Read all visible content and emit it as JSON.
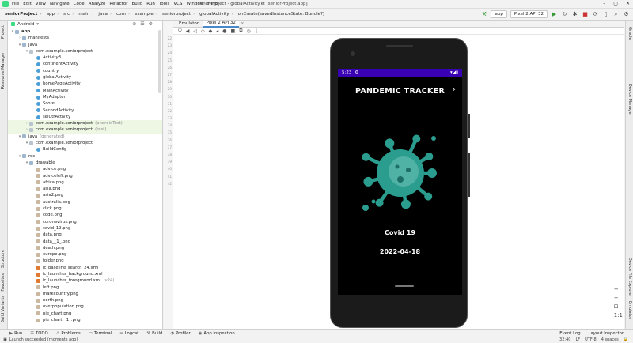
{
  "menu": {
    "items": [
      "File",
      "Edit",
      "View",
      "Navigate",
      "Code",
      "Analyze",
      "Refactor",
      "Build",
      "Run",
      "Tools",
      "VCS",
      "Window",
      "Help"
    ],
    "window_title": "seniorProject - globalActivity.kt [seniorProject.app]"
  },
  "nav": {
    "crumbs": [
      "seniorProject",
      "app",
      "src",
      "main",
      "java",
      "com",
      "example",
      "seniorproject",
      "globalActivity",
      "onCreate(savedInstanceState: Bundle?)"
    ],
    "run_config": "app",
    "device": "Pixel 2 API 32"
  },
  "left_tabs": [
    "Project",
    "Resource Manager",
    "Structure",
    "Favorites",
    "Build Variants"
  ],
  "right_tabs": [
    "Gradle",
    "Device Manager",
    "Device File Explorer",
    "Emulator"
  ],
  "project": {
    "view": "Android",
    "tree": [
      {
        "label": "app",
        "indent": 0,
        "arrow": "▾",
        "icon": "folder",
        "bold": true
      },
      {
        "label": "manifests",
        "indent": 1,
        "arrow": "›",
        "icon": "folder"
      },
      {
        "label": "java",
        "indent": 1,
        "arrow": "▾",
        "icon": "folder"
      },
      {
        "label": "com.example.seniorproject",
        "indent": 2,
        "arrow": "▾",
        "icon": "pkg"
      },
      {
        "label": "Activity3",
        "indent": 3,
        "arrow": "",
        "icon": "class"
      },
      {
        "label": "continentActivity",
        "indent": 3,
        "arrow": "",
        "icon": "class"
      },
      {
        "label": "country",
        "indent": 3,
        "arrow": "",
        "icon": "class"
      },
      {
        "label": "globalActivity",
        "indent": 3,
        "arrow": "",
        "icon": "class"
      },
      {
        "label": "homePageActivity",
        "indent": 3,
        "arrow": "",
        "icon": "class"
      },
      {
        "label": "MainActivity",
        "indent": 3,
        "arrow": "",
        "icon": "class"
      },
      {
        "label": "MyAdapter",
        "indent": 3,
        "arrow": "",
        "icon": "class"
      },
      {
        "label": "Score",
        "indent": 3,
        "arrow": "",
        "icon": "class"
      },
      {
        "label": "SecondActivity",
        "indent": 3,
        "arrow": "",
        "icon": "class"
      },
      {
        "label": "selCtrActivity",
        "indent": 3,
        "arrow": "",
        "icon": "class"
      },
      {
        "label": "com.example.seniorproject",
        "indent": 2,
        "arrow": "›",
        "icon": "pkg",
        "suffix": "(androidTest)",
        "hl": true
      },
      {
        "label": "com.example.seniorproject",
        "indent": 2,
        "arrow": "›",
        "icon": "pkg",
        "suffix": "(test)",
        "hl": true
      },
      {
        "label": "java",
        "indent": 1,
        "arrow": "▾",
        "icon": "folder",
        "suffix": "(generated)"
      },
      {
        "label": "com.example.seniorproject",
        "indent": 2,
        "arrow": "▾",
        "icon": "pkg"
      },
      {
        "label": "BuildConfig",
        "indent": 3,
        "arrow": "",
        "icon": "class"
      },
      {
        "label": "res",
        "indent": 1,
        "arrow": "▾",
        "icon": "folder"
      },
      {
        "label": "drawable",
        "indent": 2,
        "arrow": "▾",
        "icon": "folder"
      },
      {
        "label": "advice.png",
        "indent": 3,
        "arrow": "",
        "icon": "img"
      },
      {
        "label": "adviceleft.png",
        "indent": 3,
        "arrow": "",
        "icon": "img"
      },
      {
        "label": "africa.png",
        "indent": 3,
        "arrow": "",
        "icon": "img"
      },
      {
        "label": "asia.png",
        "indent": 3,
        "arrow": "",
        "icon": "img"
      },
      {
        "label": "asia2.png",
        "indent": 3,
        "arrow": "",
        "icon": "img"
      },
      {
        "label": "australia.png",
        "indent": 3,
        "arrow": "",
        "icon": "img"
      },
      {
        "label": "click.png",
        "indent": 3,
        "arrow": "",
        "icon": "img"
      },
      {
        "label": "code.png",
        "indent": 3,
        "arrow": "",
        "icon": "img"
      },
      {
        "label": "coronavirus.png",
        "indent": 3,
        "arrow": "",
        "icon": "img"
      },
      {
        "label": "covid_19.png",
        "indent": 3,
        "arrow": "",
        "icon": "img"
      },
      {
        "label": "data.png",
        "indent": 3,
        "arrow": "",
        "icon": "img"
      },
      {
        "label": "data__1_.png",
        "indent": 3,
        "arrow": "",
        "icon": "img"
      },
      {
        "label": "death.png",
        "indent": 3,
        "arrow": "",
        "icon": "img"
      },
      {
        "label": "europe.png",
        "indent": 3,
        "arrow": "",
        "icon": "img"
      },
      {
        "label": "folder.png",
        "indent": 3,
        "arrow": "",
        "icon": "img"
      },
      {
        "label": "ic_baseline_search_24.xml",
        "indent": 3,
        "arrow": "",
        "icon": "xml"
      },
      {
        "label": "ic_launcher_background.xml",
        "indent": 3,
        "arrow": "",
        "icon": "xml"
      },
      {
        "label": "ic_launcher_foreground.xml",
        "indent": 3,
        "arrow": "",
        "icon": "xml",
        "suffix": "(v24)"
      },
      {
        "label": "left.png",
        "indent": 3,
        "arrow": "",
        "icon": "img"
      },
      {
        "label": "markcountry.png",
        "indent": 3,
        "arrow": "",
        "icon": "img"
      },
      {
        "label": "north.png",
        "indent": 3,
        "arrow": "",
        "icon": "img"
      },
      {
        "label": "overpopulation.png",
        "indent": 3,
        "arrow": "",
        "icon": "img"
      },
      {
        "label": "pie_chart.png",
        "indent": 3,
        "arrow": "",
        "icon": "img"
      },
      {
        "label": "pie_chart__1_.png",
        "indent": 3,
        "arrow": "",
        "icon": "img"
      }
    ]
  },
  "emulator": {
    "tabs": [
      "Emulator:",
      "Pixel 2 API 32"
    ],
    "line_numbers": [
      "22",
      "23",
      "24",
      "25",
      "26",
      "27",
      "28",
      "29",
      "30",
      "31",
      "32",
      "33",
      "34",
      "35",
      "36",
      "37",
      "38",
      "39",
      "40",
      "41",
      "42"
    ]
  },
  "phone": {
    "time": "5:23",
    "status_icons": "▾◢▮",
    "title": "PANDEMIC TRACKER",
    "next": "›",
    "subtitle": "Covid 19",
    "date": "2022-04-18",
    "virus_color": "#2a9d8f"
  },
  "bottom": {
    "tabs": [
      "Run",
      "TODO",
      "Problems",
      "Terminal",
      "Logcat",
      "Build",
      "Profiler",
      "App Inspection"
    ],
    "right_tabs": [
      "Event Log",
      "Layout Inspector"
    ],
    "status": "Launch succeeded (moments ago)",
    "position": "32:40",
    "line_ending": "LF",
    "encoding": "UTF-8",
    "indent": "4 spaces"
  }
}
